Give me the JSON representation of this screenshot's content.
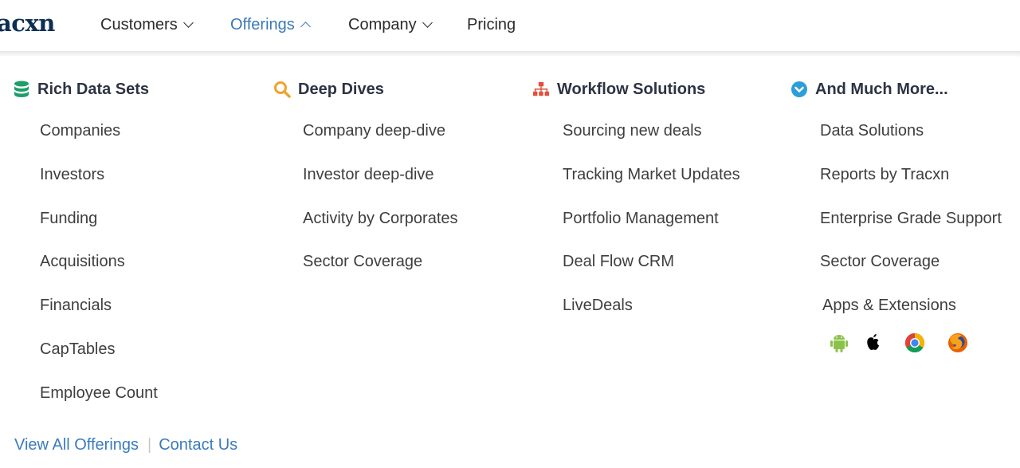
{
  "header": {
    "logo_text": "acxn",
    "nav": [
      {
        "label": "Customers",
        "state": "collapsed"
      },
      {
        "label": "Offerings",
        "state": "expanded"
      },
      {
        "label": "Company",
        "state": "collapsed"
      },
      {
        "label": "Pricing"
      }
    ]
  },
  "colors": {
    "accent": "#3a79b7",
    "green": "#1e9e6a",
    "orange": "#f0a22b",
    "red": "#e0503c",
    "blue": "#2c9ed8"
  },
  "columns": [
    {
      "title": "Rich Data Sets",
      "icon": "database-icon",
      "items": [
        "Companies",
        "Investors",
        "Funding",
        "Acquisitions",
        "Financials",
        "CapTables",
        "Employee Count"
      ]
    },
    {
      "title": "Deep Dives",
      "icon": "search-icon",
      "items": [
        "Company deep-dive",
        "Investor deep-dive",
        "Activity by Corporates",
        "Sector Coverage"
      ]
    },
    {
      "title": "Workflow Solutions",
      "icon": "sitemap-icon",
      "items": [
        "Sourcing new deals",
        "Tracking Market Updates",
        "Portfolio Management",
        "Deal Flow CRM",
        "LiveDeals"
      ]
    },
    {
      "title": "And Much More...",
      "icon": "chevron-circle-down-icon",
      "items": [
        "Data Solutions",
        "Reports by Tracxn",
        "Enterprise Grade Support",
        "Sector Coverage",
        "Apps & Extensions"
      ]
    }
  ],
  "apps": [
    "android-icon",
    "apple-icon",
    "chrome-icon",
    "firefox-icon"
  ],
  "footer": {
    "view_all": "View All Offerings",
    "separator": "|",
    "contact": "Contact Us"
  }
}
